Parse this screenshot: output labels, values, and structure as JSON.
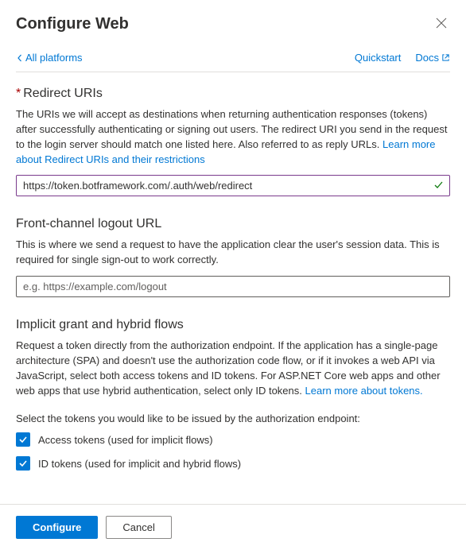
{
  "header": {
    "title": "Configure Web"
  },
  "nav": {
    "back_label": "All platforms",
    "quickstart_label": "Quickstart",
    "docs_label": "Docs"
  },
  "redirect": {
    "heading": "Redirect URIs",
    "description": "The URIs we will accept as destinations when returning authentication responses (tokens) after successfully authenticating or signing out users. The redirect URI you send in the request to the login server should match one listed here. Also referred to as reply URLs. ",
    "learn_more": "Learn more about Redirect URIs and their restrictions",
    "input_value": "https://token.botframework.com/.auth/web/redirect"
  },
  "logout": {
    "heading": "Front-channel logout URL",
    "description": "This is where we send a request to have the application clear the user's session data. This is required for single sign-out to work correctly.",
    "placeholder": "e.g. https://example.com/logout"
  },
  "implicit": {
    "heading": "Implicit grant and hybrid flows",
    "description": "Request a token directly from the authorization endpoint. If the application has a single-page architecture (SPA) and doesn't use the authorization code flow, or if it invokes a web API via JavaScript, select both access tokens and ID tokens. For ASP.NET Core web apps and other web apps that use hybrid authentication, select only ID tokens. ",
    "learn_more": "Learn more about tokens.",
    "select_label": "Select the tokens you would like to be issued by the authorization endpoint:",
    "access_tokens_label": "Access tokens (used for implicit flows)",
    "id_tokens_label": "ID tokens (used for implicit and hybrid flows)",
    "access_tokens_checked": true,
    "id_tokens_checked": true
  },
  "footer": {
    "configure_label": "Configure",
    "cancel_label": "Cancel"
  }
}
